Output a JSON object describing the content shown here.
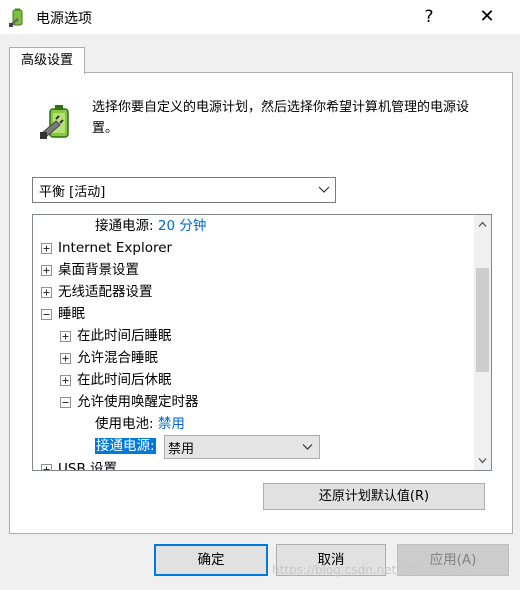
{
  "window": {
    "title": "电源选项",
    "help_glyph": "?",
    "close_glyph": "✕"
  },
  "tab": {
    "label": "高级设置"
  },
  "description": "选择你要自定义的电源计划，然后选择你希望计算机管理的电源设置。",
  "plan_select": {
    "value": "平衡 [活动]"
  },
  "tree": {
    "top_partial": {
      "label": "接通电源:",
      "value": "20 分钟"
    },
    "nodes": [
      {
        "label": "Internet Explorer",
        "expanded": false
      },
      {
        "label": "桌面背景设置",
        "expanded": false
      },
      {
        "label": "无线适配器设置",
        "expanded": false
      },
      {
        "label": "睡眠",
        "expanded": true
      }
    ],
    "sleep_children": [
      {
        "label": "在此时间后睡眠",
        "expanded": false
      },
      {
        "label": "允许混合睡眠",
        "expanded": false
      },
      {
        "label": "在此时间后休眠",
        "expanded": false
      },
      {
        "label": "允许使用唤醒定时器",
        "expanded": true
      }
    ],
    "wake_timer": {
      "battery_label": "使用电池:",
      "battery_value": "禁用",
      "plugged_label": "接通电源:",
      "plugged_value": "禁用"
    },
    "bottom_partial": {
      "label": "USB 设置"
    }
  },
  "buttons": {
    "restore": "还原计划默认值(R)",
    "ok": "确定",
    "cancel": "取消",
    "apply": "应用(A)"
  },
  "watermark": "https://blog.csdn.net/hardmaster",
  "colors": {
    "accent": "#0078d7",
    "value_link": "#0066cc"
  }
}
